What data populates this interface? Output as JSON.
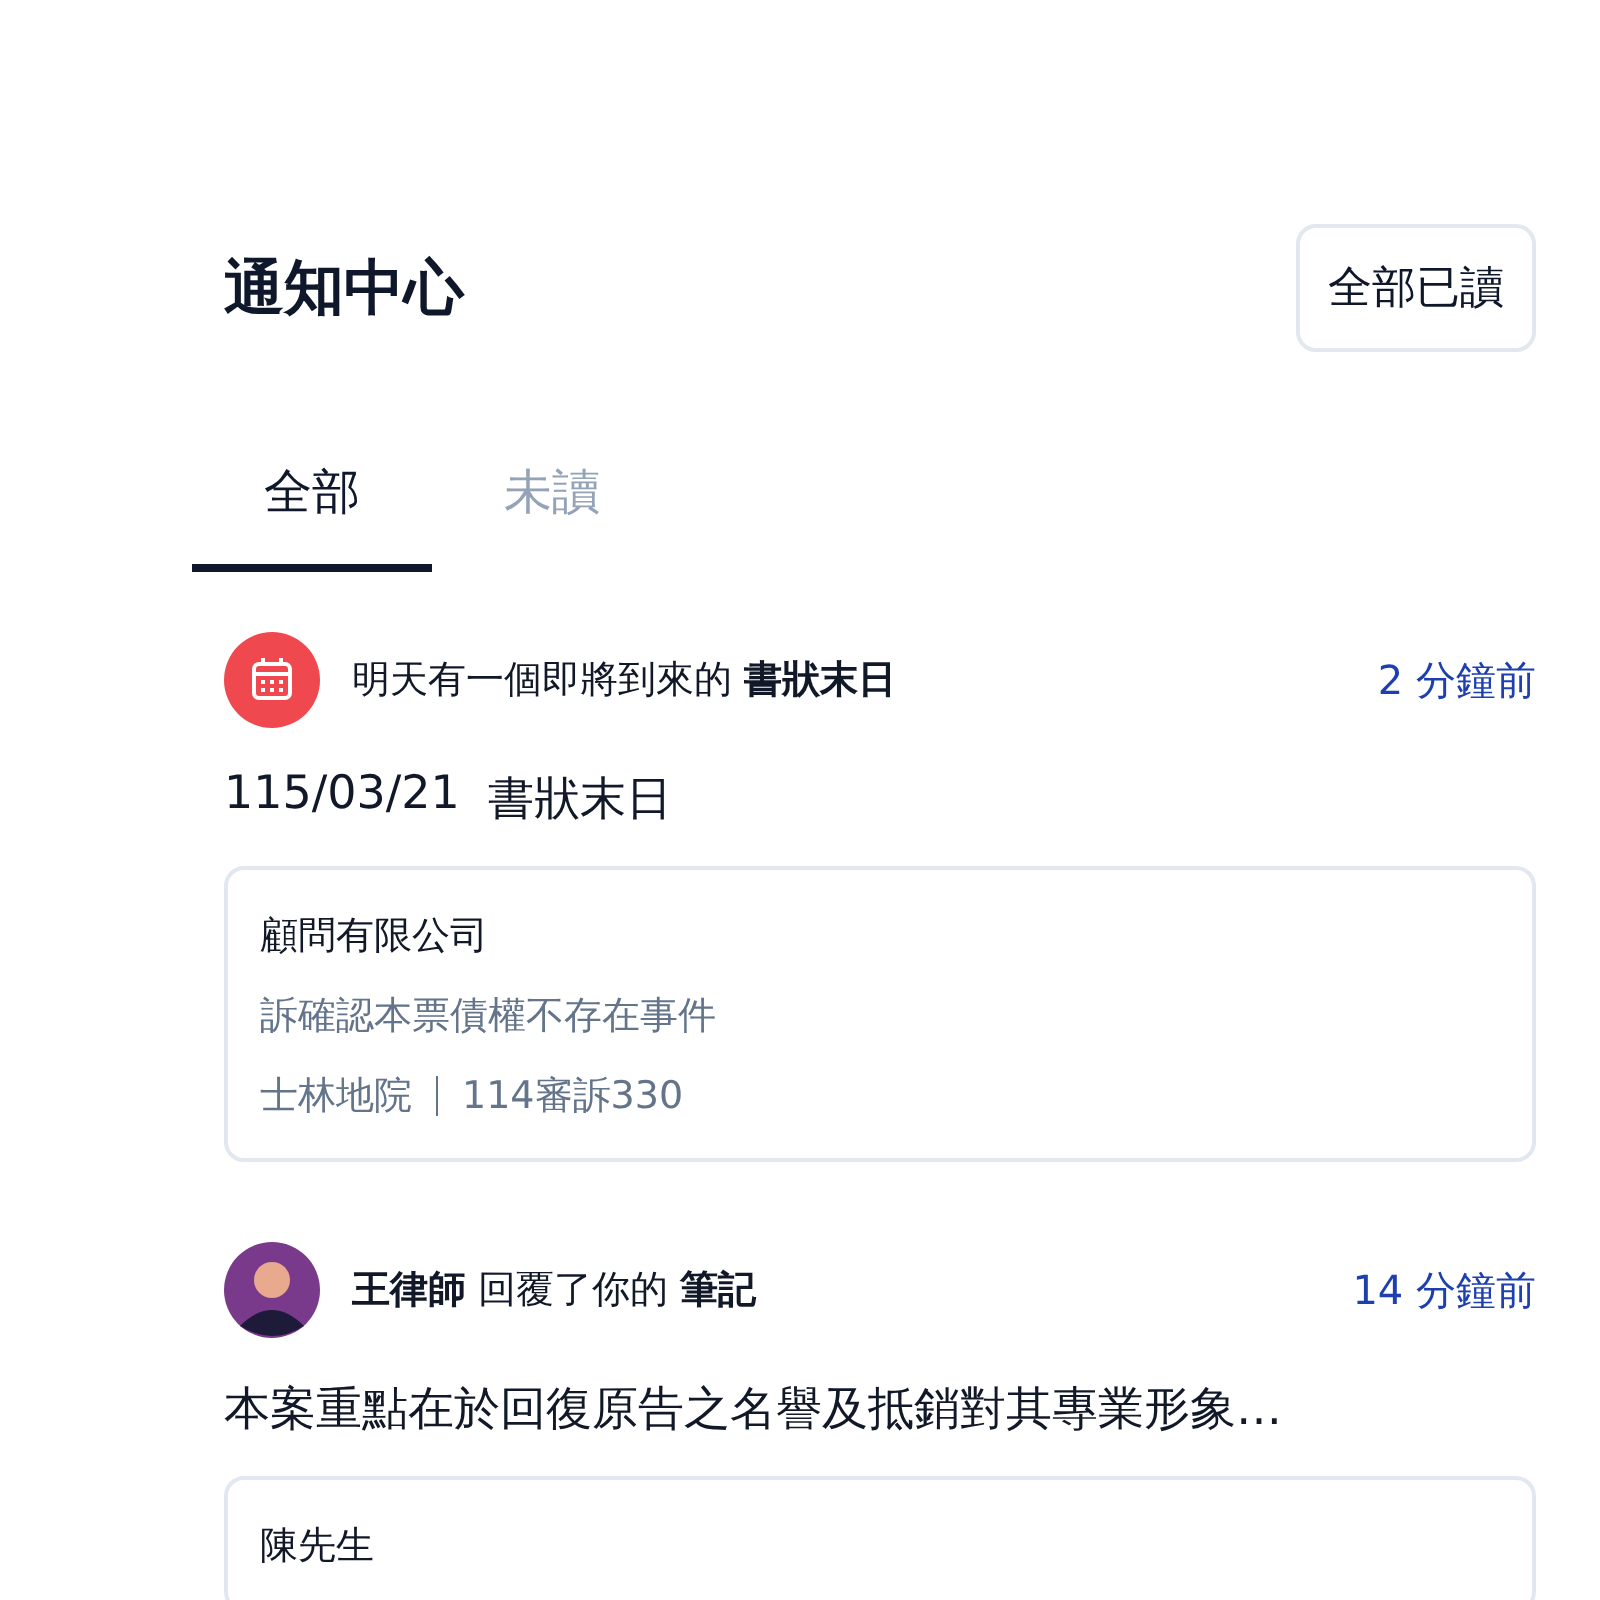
{
  "header": {
    "title": "通知中心",
    "mark_all_button": "全部已讀"
  },
  "tabs": [
    {
      "label": "全部",
      "selected": true
    },
    {
      "label": "未讀",
      "selected": false
    }
  ],
  "notifications": [
    {
      "kind": "deadline",
      "summary": "明天有一個即將到來的 **書狀末日**",
      "time": "2 分鐘前",
      "date": "115/03/21",
      "message": "書狀末日",
      "card": {
        "party": "顧問有限公司",
        "subject": "訴確認本票債權不存在事件",
        "court": "士林地院",
        "case_no": "114審訴330"
      }
    },
    {
      "kind": "reply",
      "summary": "**王律師** 回覆了你的 **筆記**",
      "time": "14 分鐘前",
      "message": "本案重點在於回復原告之名譽及抵銷對其專業形象…",
      "card": {
        "party": "陳先生"
      }
    }
  ]
}
